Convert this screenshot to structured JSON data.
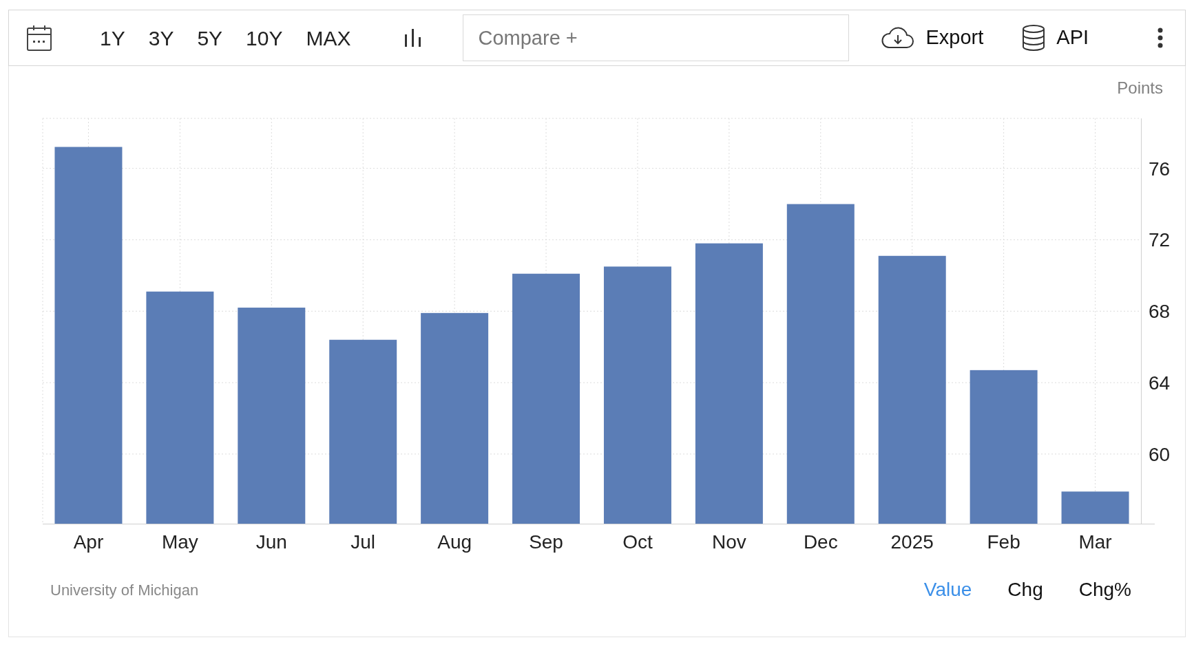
{
  "toolbar": {
    "ranges": [
      "1Y",
      "3Y",
      "5Y",
      "10Y",
      "MAX"
    ],
    "compare": {
      "placeholder": "Compare +"
    },
    "export": "Export",
    "api": "API"
  },
  "chart": {
    "chart_data": {
      "type": "bar",
      "ylabel": "Points",
      "categories": [
        "Apr",
        "May",
        "Jun",
        "Jul",
        "Aug",
        "Sep",
        "Oct",
        "Nov",
        "Dec",
        "2025",
        "Feb",
        "Mar"
      ],
      "grid": true,
      "series": [
        {
          "color": "#5b7db6",
          "values": [
            77.2,
            69.1,
            68.2,
            66.4,
            67.9,
            70.1,
            70.5,
            71.8,
            74.0,
            71.1,
            64.7,
            57.9
          ]
        }
      ],
      "ylim": [
        56.1,
        78.8
      ],
      "yticks": [
        60,
        64,
        68,
        72,
        76
      ]
    }
  },
  "footer": {
    "source": "University of Michigan",
    "modes": [
      {
        "label": "Value",
        "selected": true
      },
      {
        "label": "Chg",
        "selected": false
      },
      {
        "label": "Chg%",
        "selected": false
      }
    ]
  }
}
